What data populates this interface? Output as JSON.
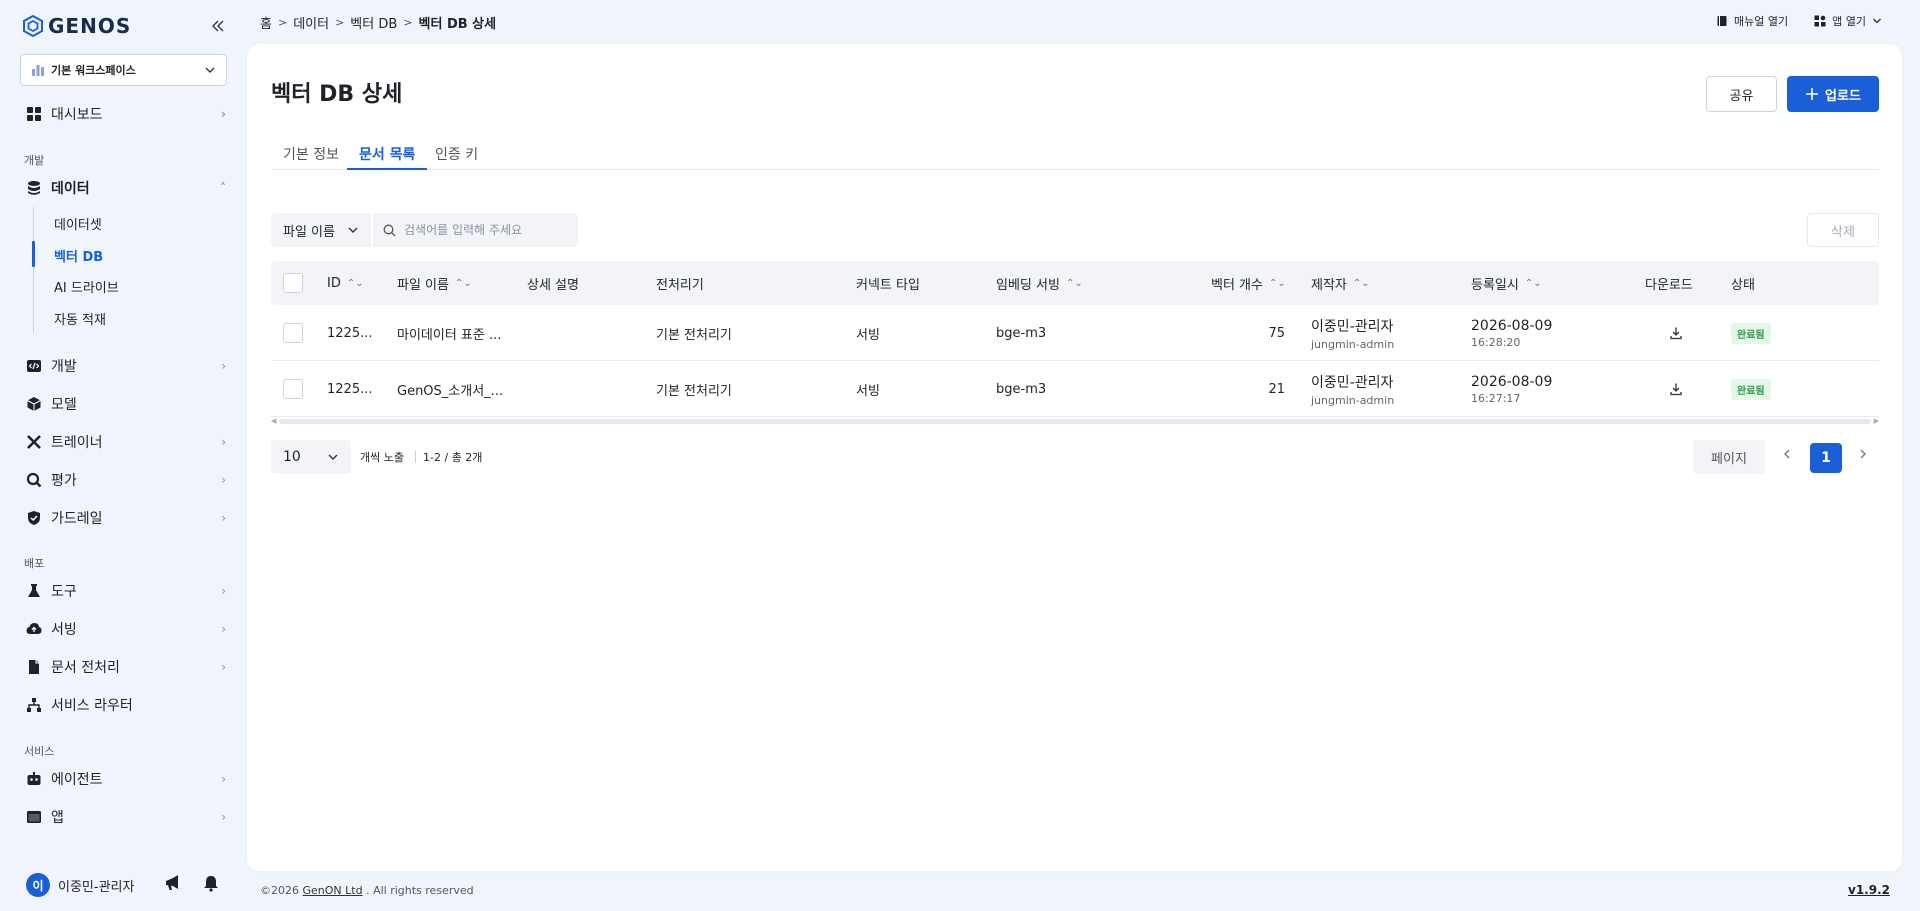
{
  "brand": {
    "logo_text": "GENOS"
  },
  "workspace": {
    "label": "기본 워크스페이스"
  },
  "sidebar": {
    "dashboard": "대시보드",
    "section_dev": "개발",
    "data": "데이터",
    "data_sub": [
      "데이터셋",
      "벡터 DB",
      "AI 드라이브",
      "자동 적재"
    ],
    "dev": "개발",
    "model": "모델",
    "trainer": "트레이너",
    "eval": "평가",
    "guardrail": "가드레일",
    "section_deploy": "배포",
    "tools": "도구",
    "serving": "서빙",
    "doc_preproc": "문서 전처리",
    "service_router": "서비스 라우터",
    "section_service": "서비스",
    "agent": "에이전트",
    "app": "앱"
  },
  "user": {
    "avatar_initial": "이",
    "name": "이중민-관리자"
  },
  "breadcrumb": [
    "홈",
    "데이터",
    "벡터 DB",
    "벡터 DB 상세"
  ],
  "topbar": {
    "manual": "매뉴얼 열기",
    "open_app": "앱 열기"
  },
  "page": {
    "title": "벡터 DB 상세",
    "share_label": "공유",
    "upload_label": "업로드",
    "tabs": [
      "기본 정보",
      "문서 목록",
      "인증 키"
    ],
    "active_tab": 1
  },
  "filter": {
    "field": "파일 이름",
    "search_placeholder": "검색어를 입력해 주세요",
    "delete_label": "삭제"
  },
  "table": {
    "headers": [
      "ID",
      "파일 이름",
      "상세 설명",
      "전처리기",
      "커넥트 타입",
      "임베딩 서빙",
      "벡터 개수",
      "제작자",
      "등록일시",
      "다운로드",
      "상태"
    ],
    "rows": [
      {
        "id": "1225...",
        "file": "마이데이터 표준 ...",
        "desc": "",
        "preproc": "기본 전처리기",
        "connect": "서빙",
        "embed": "bge-m3",
        "vectors": "75",
        "creator": "이중민-관리자",
        "creator_id": "jungmin-admin",
        "date": "2026-08-09",
        "time": "16:28:20",
        "status": "완료됨"
      },
      {
        "id": "1225...",
        "file": "GenOS_소개서_...",
        "desc": "",
        "preproc": "기본 전처리기",
        "connect": "서빙",
        "embed": "bge-m3",
        "vectors": "21",
        "creator": "이중민-관리자",
        "creator_id": "jungmin-admin",
        "date": "2026-08-09",
        "time": "16:27:17",
        "status": "완료됨"
      }
    ]
  },
  "pagination": {
    "page_size": "10",
    "per_label": "개씩 노출",
    "range": "1-2 / 총 2개",
    "page_button": "페이지",
    "current": "1"
  },
  "footer": {
    "copyright_prefix": "©2026",
    "company": "GenON Ltd",
    "suffix": ". All rights reserved",
    "version": "v1.9.2"
  },
  "colors": {
    "accent": "#1a5fd8",
    "status_done_bg": "#e6f6ea",
    "status_done_fg": "#2e9b4a"
  }
}
